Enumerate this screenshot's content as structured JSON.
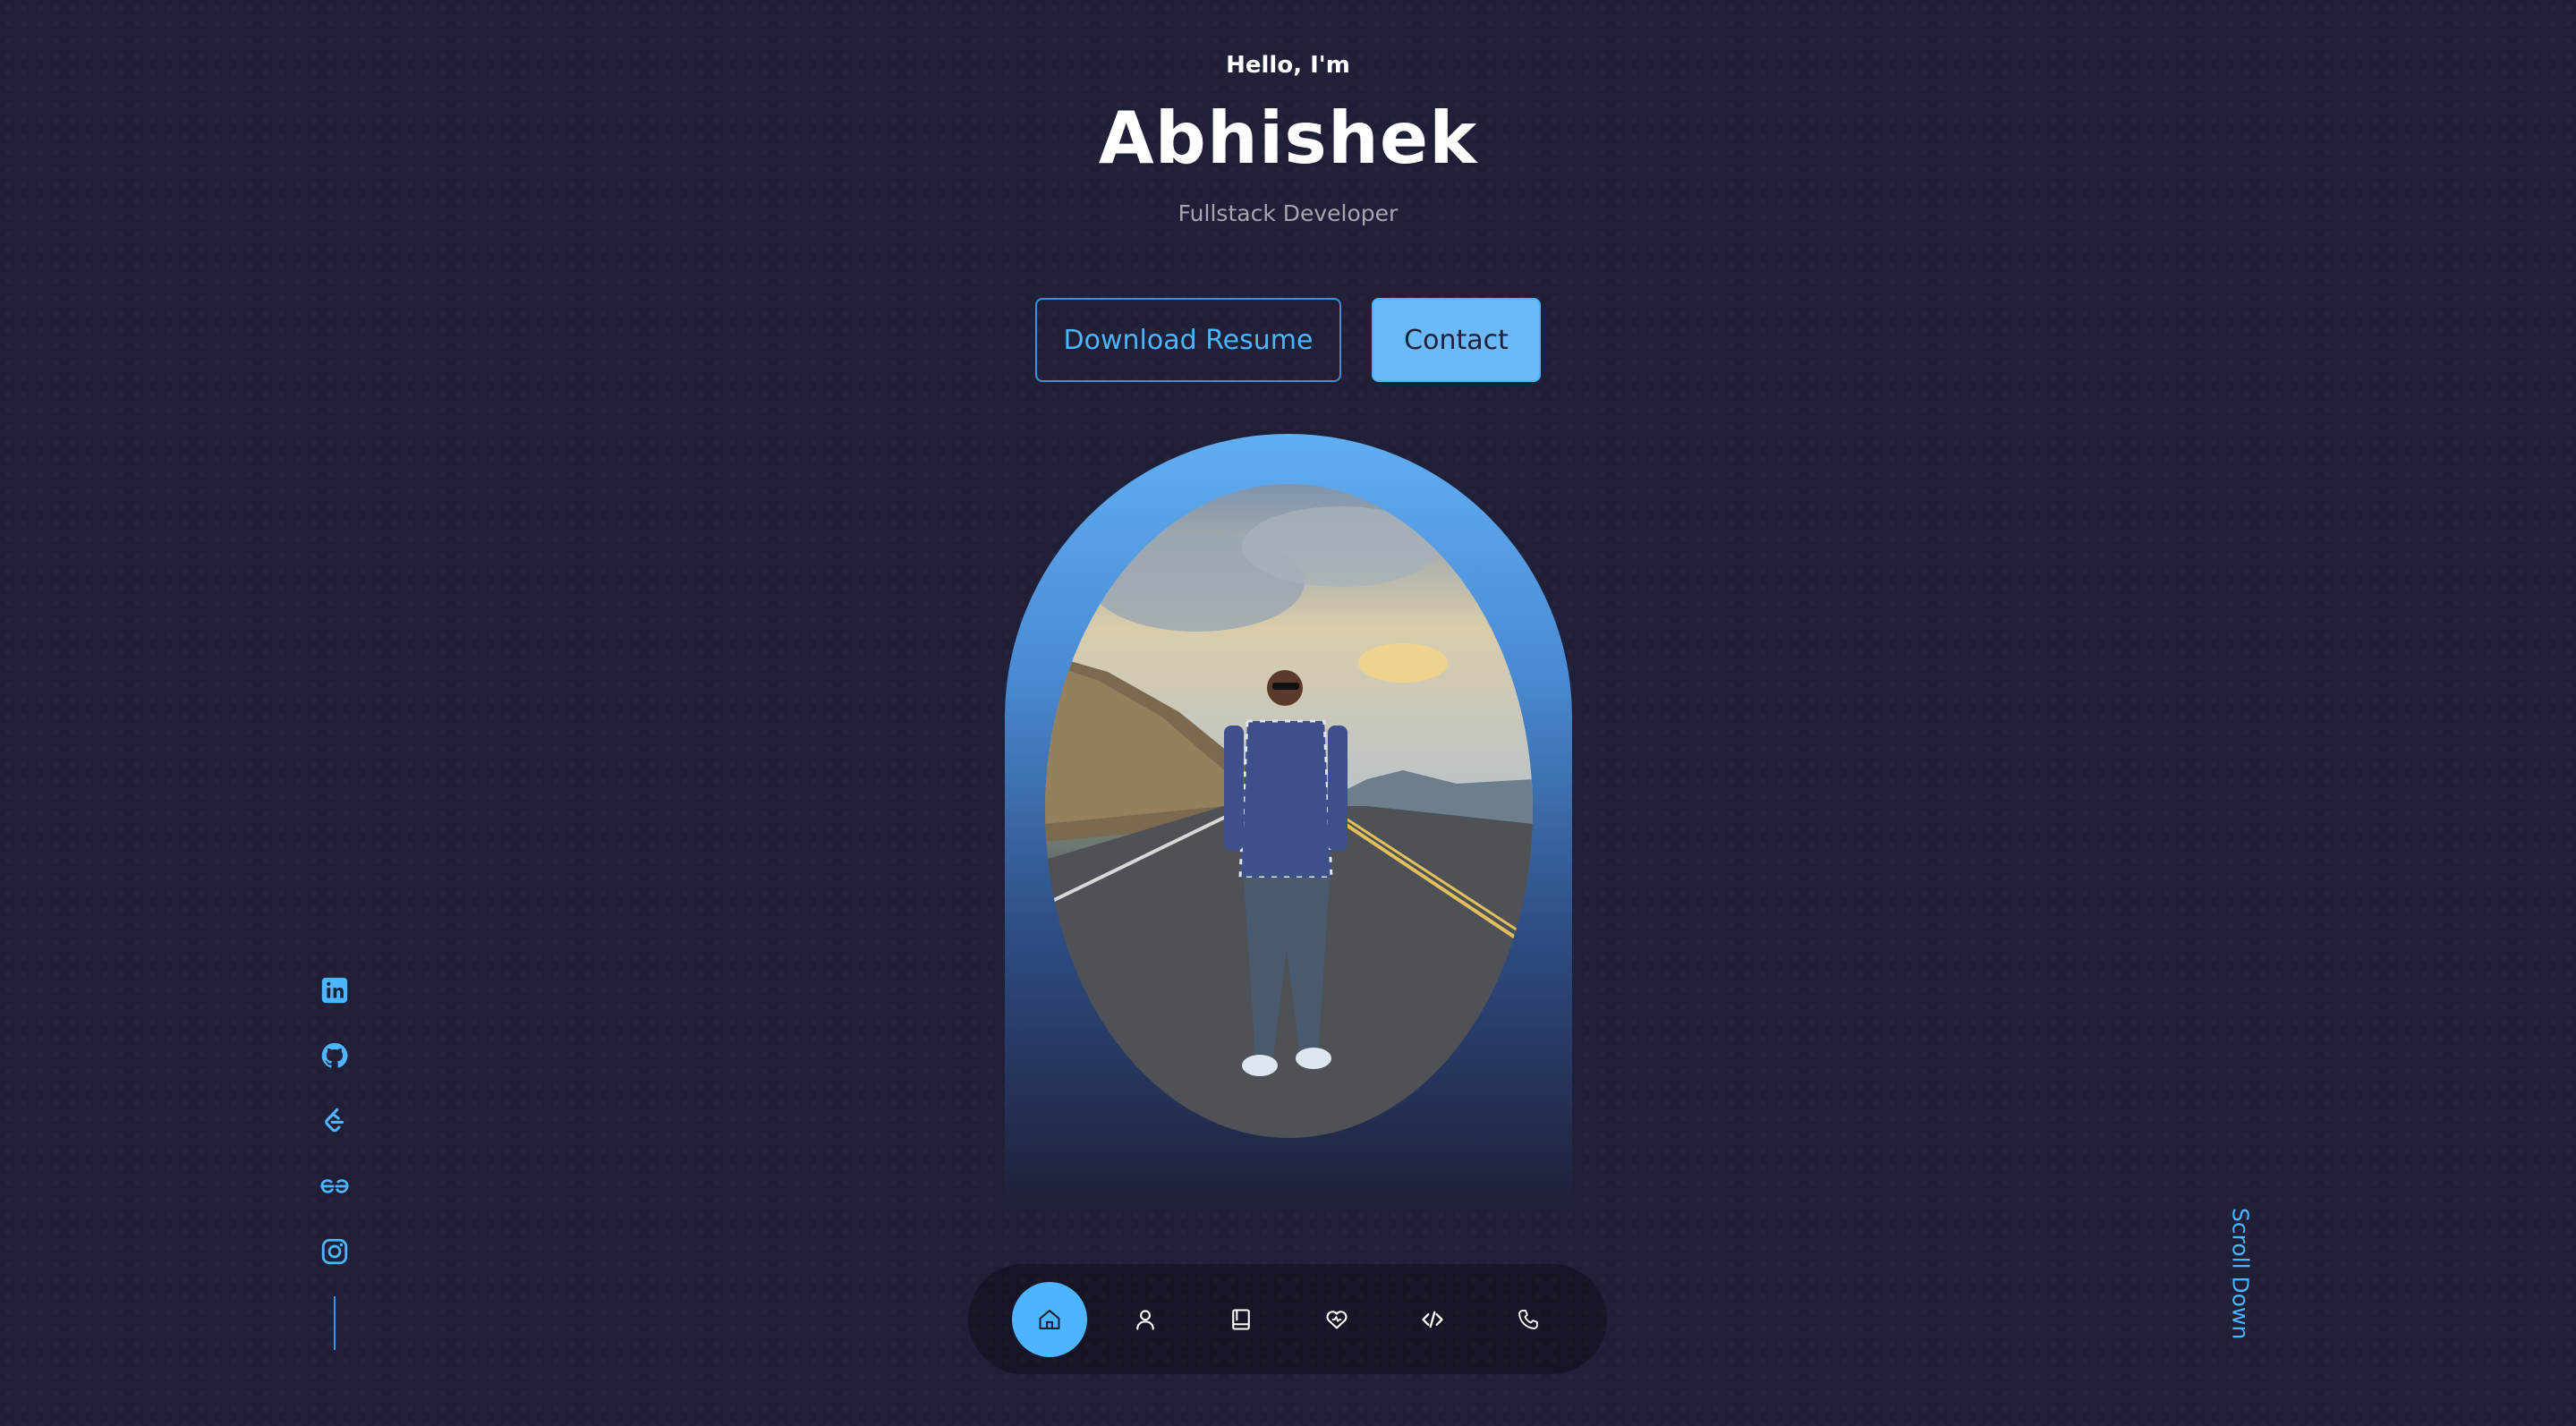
{
  "header": {
    "greeting": "Hello, I'm",
    "name": "Abhishek",
    "role": "Fullstack Developer"
  },
  "cta": {
    "download_label": "Download Resume",
    "contact_label": "Contact"
  },
  "socials": [
    {
      "icon": "linkedin-icon"
    },
    {
      "icon": "github-icon"
    },
    {
      "icon": "leetcode-icon"
    },
    {
      "icon": "geeksforgeeks-icon"
    },
    {
      "icon": "instagram-icon"
    }
  ],
  "scroll": {
    "label": "Scroll Down"
  },
  "nav": [
    {
      "icon": "home-icon",
      "active": true
    },
    {
      "icon": "user-icon"
    },
    {
      "icon": "book-icon"
    },
    {
      "icon": "heart-icon"
    },
    {
      "icon": "code-icon"
    },
    {
      "icon": "phone-icon"
    }
  ],
  "colors": {
    "background": "#1f1f38",
    "accent": "#4db5ff",
    "text": "#ffffff"
  }
}
